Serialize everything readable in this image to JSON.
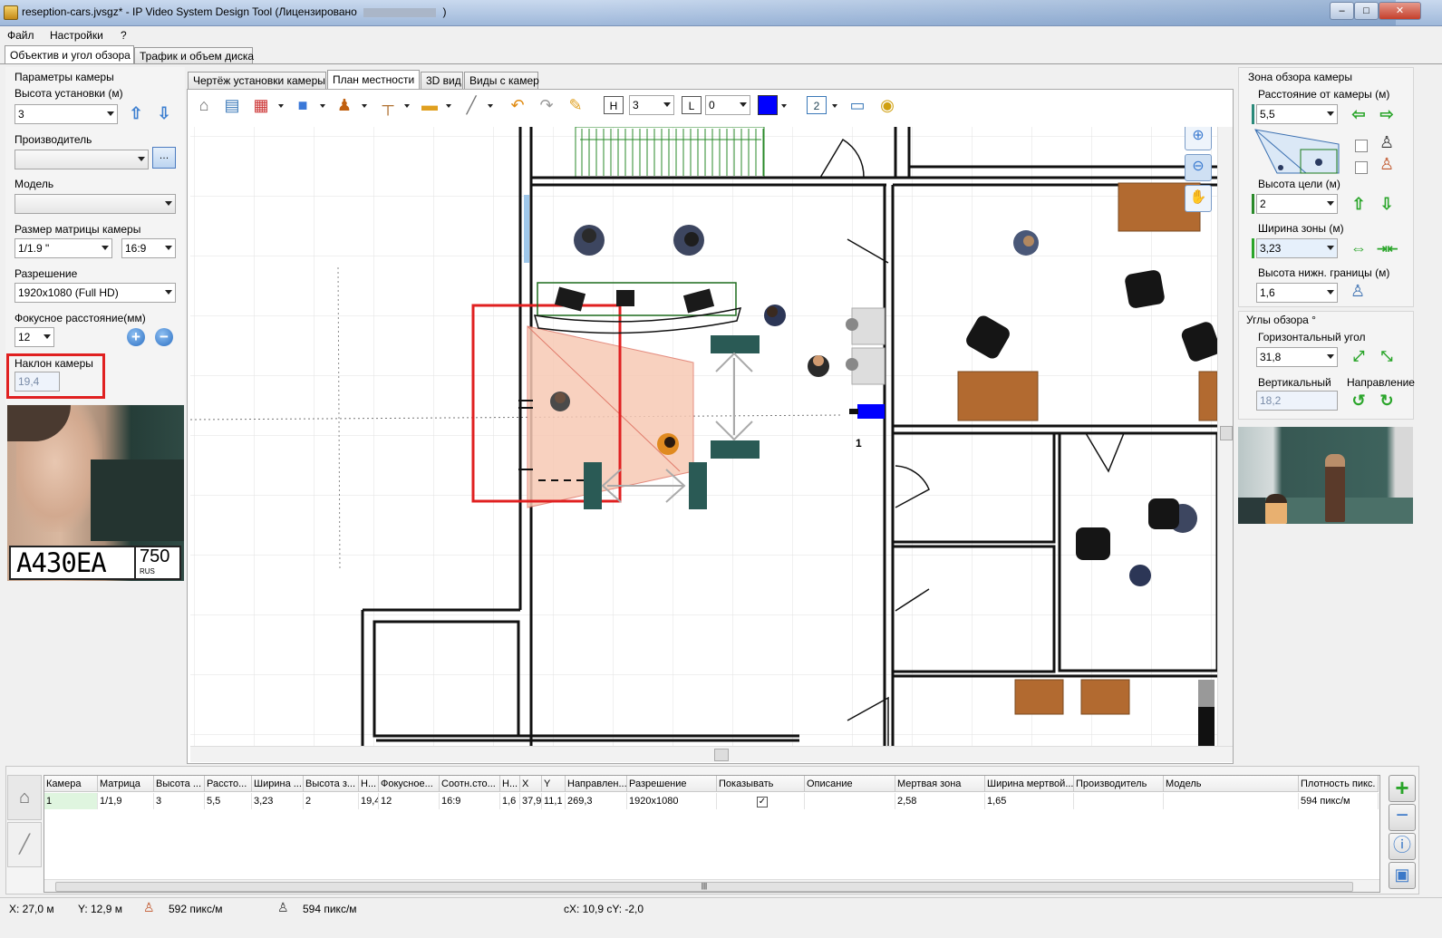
{
  "window": {
    "title": "reseption-cars.jvsgz* - IP Video System Design Tool (Лицензировано",
    "title_suffix": ")",
    "min_glyph": "–",
    "max_glyph": "□",
    "close_glyph": "✕"
  },
  "menu": {
    "file": "Файл",
    "settings": "Настройки",
    "help": "?"
  },
  "main_tabs": [
    "Объектив и угол обзора",
    "Трафик и объем диска"
  ],
  "view_tabs": [
    "Чертёж установки камеры",
    "План местности",
    "3D вид",
    "Виды с камер"
  ],
  "left_panel": {
    "section_title": "Параметры камеры",
    "height_label": "Высота установки (м)",
    "height_value": "3",
    "manufacturer_label": "Производитель",
    "manufacturer_value": "",
    "model_label": "Модель",
    "model_value": "",
    "sensor_label": "Размер матрицы камеры",
    "sensor_value": "1/1.9 \"",
    "aspect_value": "16:9",
    "resolution_label": "Разрешение",
    "resolution_value": "1920x1080 (Full HD)",
    "focal_label": "Фокусное расстояние(мм)",
    "focal_value": "12",
    "tilt_label": "Наклон камеры",
    "tilt_value": "19,4",
    "plus_glyph": "+",
    "minus_glyph": "−",
    "plate_text": "A430EA",
    "plate_region": "750",
    "plate_country": "RUS"
  },
  "toolbar": {
    "h_label": "H",
    "h_value": "3",
    "l_label": "L",
    "l_value": "0",
    "page_value": "2",
    "color_accent": "#0000ff"
  },
  "canvas": {
    "camera_number": "1"
  },
  "right_panel": {
    "zone_title": "Зона обзора камеры",
    "distance_label": "Расстояние от камеры (м)",
    "distance_value": "5,5",
    "target_height_label": "Высота цели (м)",
    "target_height_value": "2",
    "zone_width_label": "Ширина зоны (м)",
    "zone_width_value": "3,23",
    "lower_bound_label": "Высота нижн. границы (м)",
    "lower_bound_value": "1,6",
    "angles_title": "Углы обзора °",
    "horizontal_label": "Горизонтальный угол",
    "horizontal_value": "31,8",
    "vertical_label": "Вертикальный",
    "vertical_value": "18,2",
    "direction_label": "Направление"
  },
  "table": {
    "headers": [
      "Камера",
      "Матрица",
      "Высота ...",
      "Рассто...",
      "Ширина ...",
      "Высота з...",
      "Н...",
      "Фокусное...",
      "Соотн.сто...",
      "Н...",
      "X",
      "Y",
      "Направлен...",
      "Разрешение",
      "Показывать",
      "Описание",
      "Мертвая зона",
      "Ширина мертвой...",
      "Производитель",
      "Модель",
      "Плотность пикс."
    ],
    "row": [
      "1",
      "1/1,9",
      "3",
      "5,5",
      "3,23",
      "2",
      "19,4",
      "12",
      "16:9",
      "1,6",
      "37,9",
      "11,1",
      "269,3",
      "1920x1080",
      "",
      "",
      "2,58",
      "1,65",
      "",
      "",
      "594 пикс/м"
    ],
    "show_checked": true,
    "scroll_grip": "|||"
  },
  "status": {
    "x": "X: 27,0 м",
    "y": "Y: 12,9 м",
    "density1": "592 пикс/м",
    "density2": "594 пикс/м",
    "center": "cX: 10,9 cY: -2,0"
  },
  "colors": {
    "accent_red": "#e02020",
    "fov_fill": "#f7c9b5",
    "wall": "#111111",
    "green_arrow": "#2aa52a"
  }
}
